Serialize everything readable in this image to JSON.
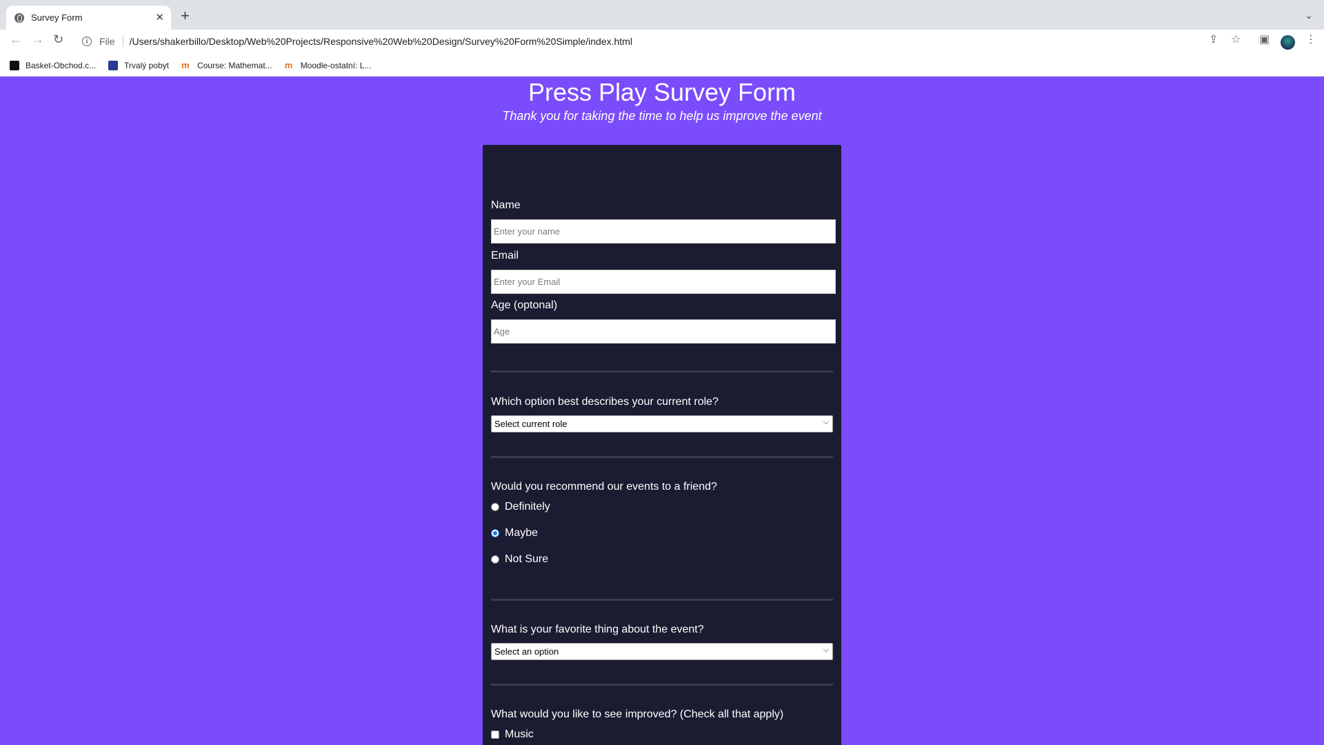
{
  "browser": {
    "tab_title": "Survey Form",
    "new_tab_label": "+",
    "scheme_label": "File",
    "url": "/Users/shakerbillo/Desktop/Web%20Projects/Responsive%20Web%20Design/Survey%20Form%20Simple/index.html",
    "bookmarks": [
      {
        "label": "Basket-Obchod.c..."
      },
      {
        "label": "Trvalý pobyt"
      },
      {
        "label": "Course: Mathemat..."
      },
      {
        "label": "Moodle-ostatní: L..."
      }
    ]
  },
  "page": {
    "title": "Press Play Survey Form",
    "description": "Thank you for taking the time to help us improve the event"
  },
  "form": {
    "name_label": "Name",
    "name_placeholder": "Enter your name",
    "email_label": "Email",
    "email_placeholder": "Enter your Email",
    "age_label": "Age (optonal)",
    "age_placeholder": "Age",
    "role_question": "Which option best describes your current role?",
    "role_selected": "Select current role",
    "recommend_question": "Would you recommend our events to a friend?",
    "recommend_options": [
      {
        "label": "Definitely",
        "checked": false
      },
      {
        "label": "Maybe",
        "checked": true
      },
      {
        "label": "Not Sure",
        "checked": false
      }
    ],
    "favorite_question": "What is your favorite thing about the event?",
    "favorite_selected": "Select an option",
    "improve_question": "What would you like to see improved? (Check all that apply)",
    "improve_options": [
      {
        "label": "Music",
        "checked": false
      }
    ]
  },
  "colors": {
    "page_background": "#7a4cfb",
    "form_background": "#1b1b32",
    "radio_accent": "#1a73e8"
  }
}
